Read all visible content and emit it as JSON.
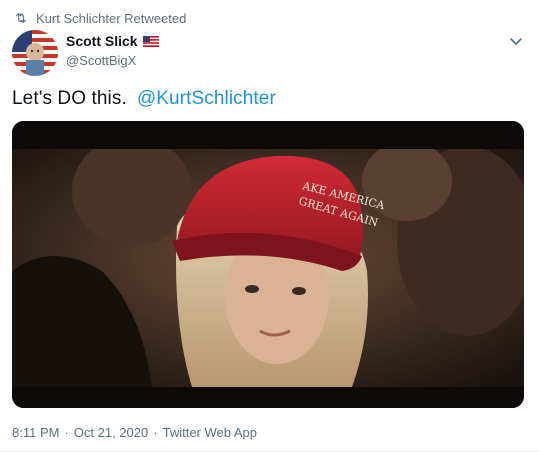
{
  "retweet": {
    "icon": "retweet-icon",
    "label": "Kurt Schlichter Retweeted"
  },
  "author": {
    "name": "Scott Slick",
    "flag": "us-flag-emoji",
    "handle": "@ScottBigX",
    "avatar": "avatar-image"
  },
  "menu": {
    "icon": "chevron-down-icon"
  },
  "tweet": {
    "text": "Let's DO this.",
    "mention": "@KurtSchlichter"
  },
  "media": {
    "type": "video-thumbnail",
    "hat_text_line1": "AKE AMERICA",
    "hat_text_line2": "GREAT AGAIN"
  },
  "meta": {
    "time": "8:11 PM",
    "date": "Oct 21, 2020",
    "separator": "·",
    "source": "Twitter Web App"
  },
  "colors": {
    "link": "#1b95e0",
    "secondary_text": "#5b7083",
    "primary_text": "#0f1419"
  }
}
